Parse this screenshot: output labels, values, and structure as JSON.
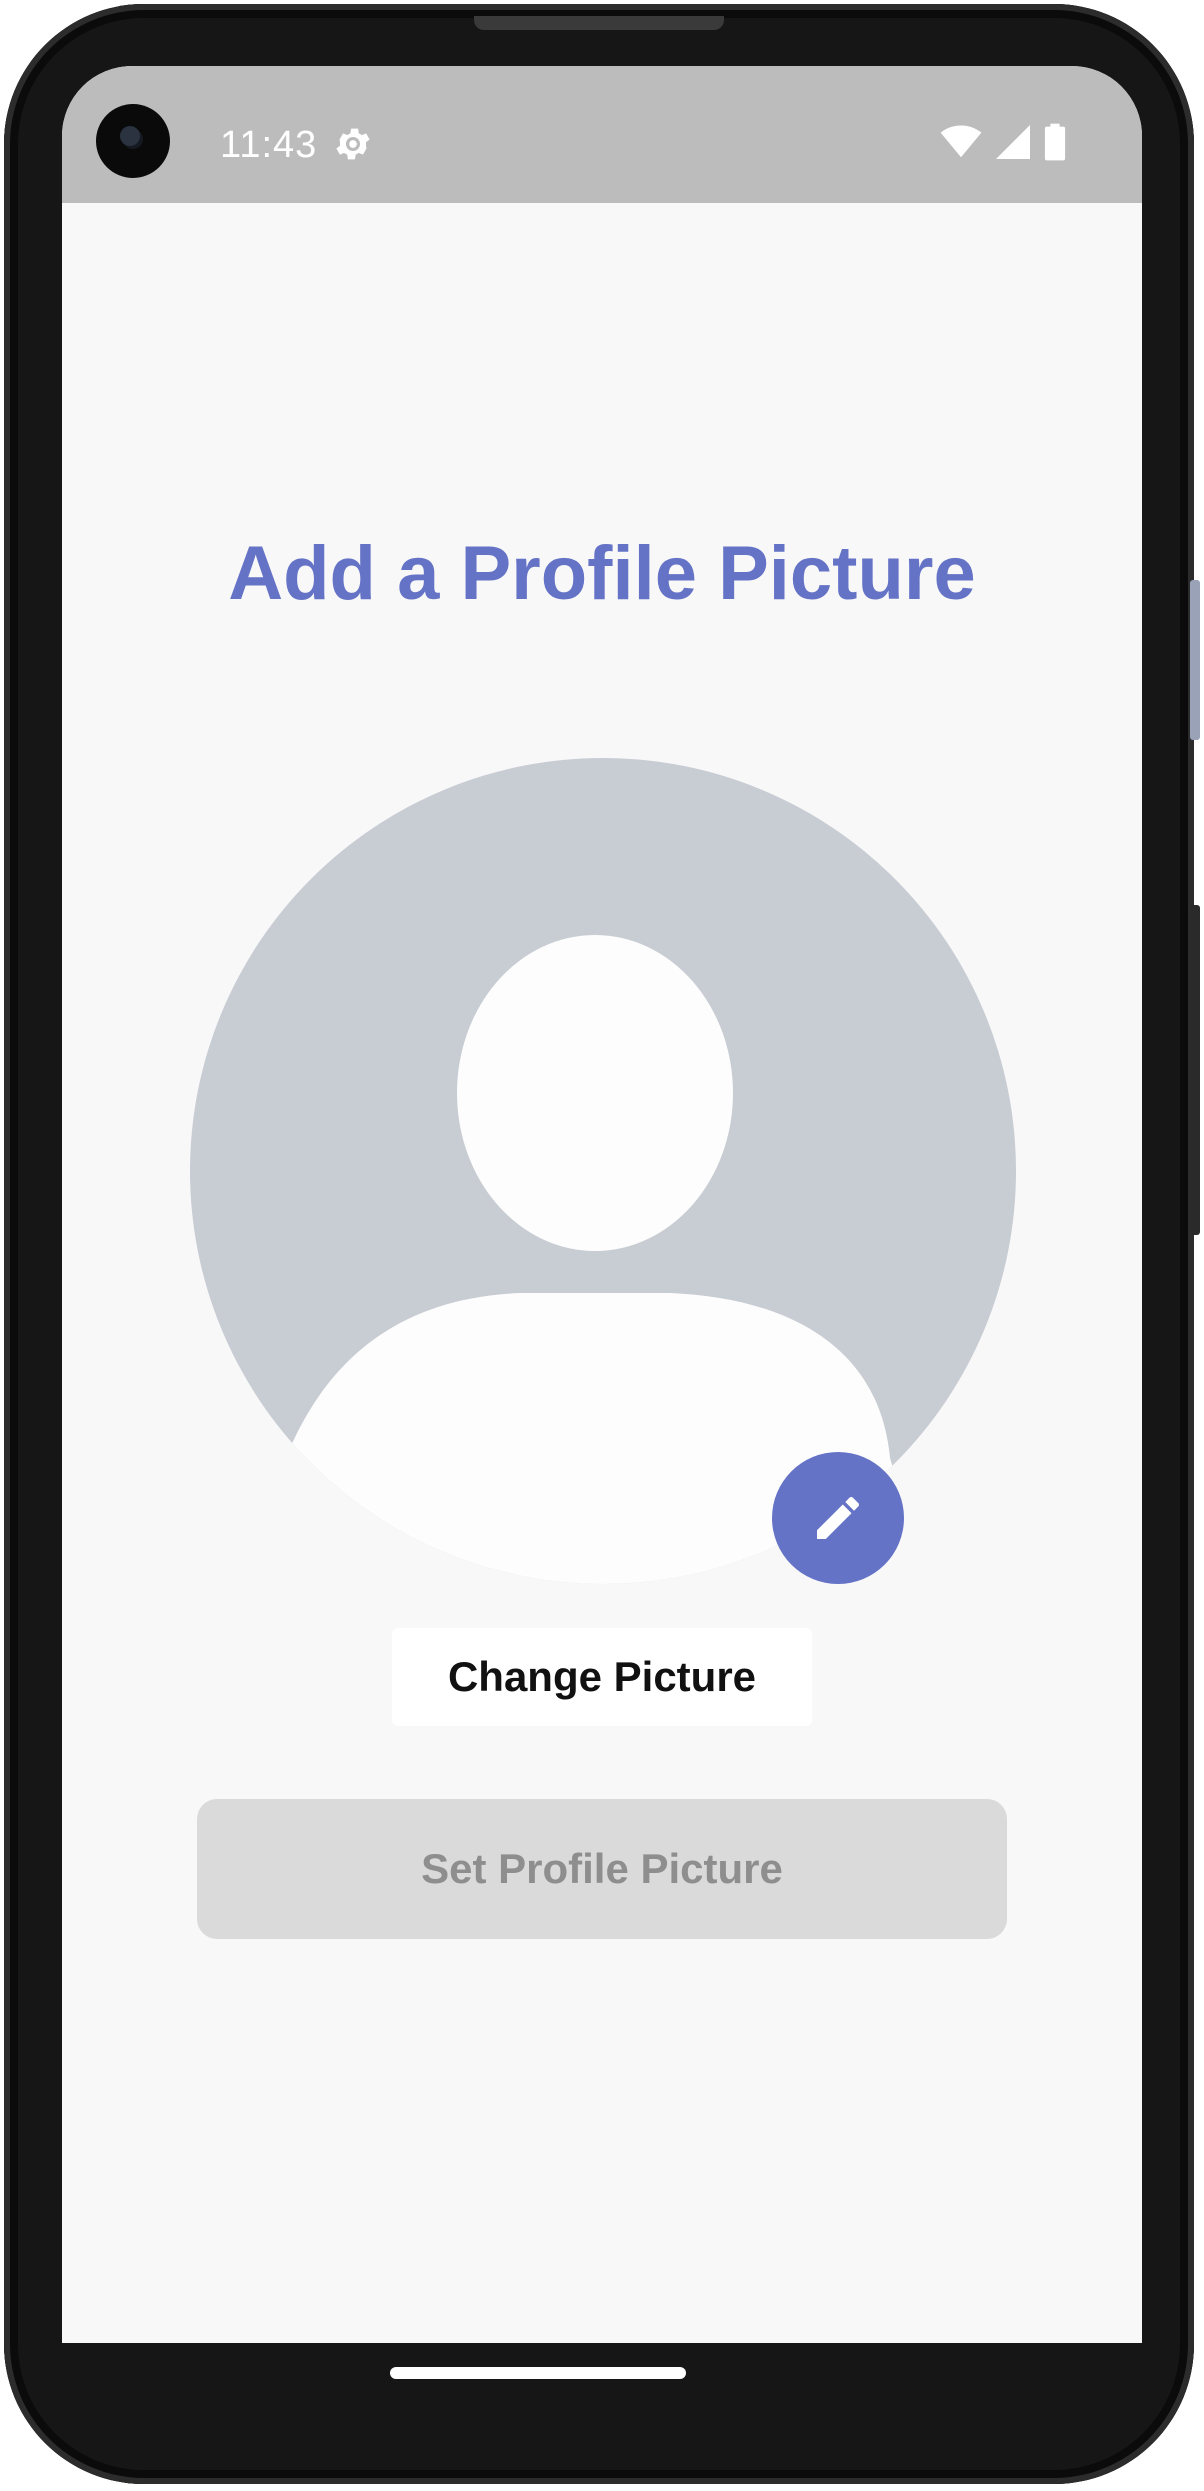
{
  "status_bar": {
    "time": "11:43",
    "icons": [
      "settings-gear-icon",
      "wifi-icon",
      "cell-signal-icon",
      "battery-icon"
    ]
  },
  "screen": {
    "title": "Add a Profile Picture",
    "avatar_icon": "default-user-silhouette-icon",
    "edit_icon": "pencil-icon",
    "change_picture_label": "Change Picture",
    "set_picture_label": "Set Profile Picture",
    "set_picture_enabled": false
  },
  "colors": {
    "accent": "#6573c6",
    "background": "#f8f8f9",
    "status_bar": "#bcbcbc",
    "avatar_bg": "#c8ccd3",
    "disabled_button": "#dadada",
    "disabled_text": "#8e8e8e"
  }
}
